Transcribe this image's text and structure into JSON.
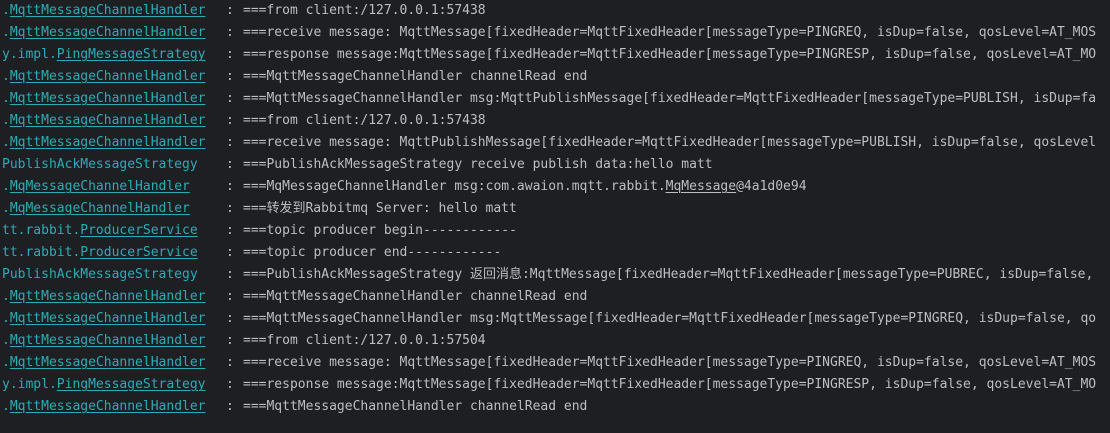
{
  "console": {
    "lines": [
      {
        "pkg": ".",
        "cls": "MqttMessageChannelHandler",
        "sep": ":",
        "msg": "===from client:/127.0.0.1:57438"
      },
      {
        "pkg": ".",
        "cls": "MqttMessageChannelHandler",
        "sep": ":",
        "msg": "===receive message: MqttMessage[fixedHeader=MqttFixedHeader[messageType=PINGREQ, isDup=false, qosLevel=AT_MOS"
      },
      {
        "pkg": "y.impl.",
        "cls": "PingMessageStrategy",
        "sep": ":",
        "msg": "===response message:MqttMessage[fixedHeader=MqttFixedHeader[messageType=PINGRESP, isDup=false, qosLevel=AT_MO"
      },
      {
        "pkg": ".",
        "cls": "MqttMessageChannelHandler",
        "sep": ":",
        "msg": "===MqttMessageChannelHandler channelRead end"
      },
      {
        "pkg": ".",
        "cls": "MqttMessageChannelHandler",
        "sep": ":",
        "msg": "===MqttMessageChannelHandler msg:MqttPublishMessage[fixedHeader=MqttFixedHeader[messageType=PUBLISH, isDup=fa"
      },
      {
        "pkg": ".",
        "cls": "MqttMessageChannelHandler",
        "sep": ":",
        "msg": "===from client:/127.0.0.1:57438"
      },
      {
        "pkg": ".",
        "cls": "MqttMessageChannelHandler",
        "sep": ":",
        "msg": "===receive message: MqttPublishMessage[fixedHeader=MqttFixedHeader[messageType=PUBLISH, isDup=false, qosLevel"
      },
      {
        "pkg": "PublishAckMessageStrategy",
        "cls": "",
        "sep": ":",
        "msg": "===PublishAckMessageStrategy receive publish data:hello matt"
      },
      {
        "pkg": ".",
        "cls": "MqMessageChannelHandler",
        "sep": ":",
        "msg_pre": "===MqMessageChannelHandler msg:com.awaion.mqtt.rabbit.",
        "msg_link": "MqMessage",
        "msg_post": "@4a1d0e94"
      },
      {
        "pkg": ".",
        "cls": "MqMessageChannelHandler",
        "sep": ":",
        "msg": "===转发到Rabbitmq Server: hello matt"
      },
      {
        "pkg": "tt.rabbit.",
        "cls": "ProducerService",
        "sep": ":",
        "msg": "===topic producer begin------------"
      },
      {
        "pkg": "tt.rabbit.",
        "cls": "ProducerService",
        "sep": ":",
        "msg": "===topic producer end------------"
      },
      {
        "pkg": "PublishAckMessageStrategy",
        "cls": "",
        "sep": ":",
        "msg": "===PublishAckMessageStrategy 返回消息:MqttMessage[fixedHeader=MqttFixedHeader[messageType=PUBREC, isDup=false,"
      },
      {
        "pkg": ".",
        "cls": "MqttMessageChannelHandler",
        "sep": ":",
        "msg": "===MqttMessageChannelHandler channelRead end"
      },
      {
        "pkg": ".",
        "cls": "MqttMessageChannelHandler",
        "sep": ":",
        "msg": "===MqttMessageChannelHandler msg:MqttMessage[fixedHeader=MqttFixedHeader[messageType=PINGREQ, isDup=false, qo"
      },
      {
        "pkg": ".",
        "cls": "MqttMessageChannelHandler",
        "sep": ":",
        "msg": "===from client:/127.0.0.1:57504"
      },
      {
        "pkg": ".",
        "cls": "MqttMessageChannelHandler",
        "sep": ":",
        "msg": "===receive message: MqttMessage[fixedHeader=MqttFixedHeader[messageType=PINGREQ, isDup=false, qosLevel=AT_MOS"
      },
      {
        "pkg": "y.impl.",
        "cls": "PingMessageStrategy",
        "sep": ":",
        "msg": "===response message:MqttMessage[fixedHeader=MqttFixedHeader[messageType=PINGRESP, isDup=false, qosLevel=AT_MO"
      },
      {
        "pkg": ".",
        "cls": "MqttMessageChannelHandler",
        "sep": ":",
        "msg": "===MqttMessageChannelHandler channelRead end"
      }
    ]
  },
  "colors": {
    "background": "#1e1f22",
    "logger": "#2aacb8",
    "text": "#bcbec4"
  }
}
